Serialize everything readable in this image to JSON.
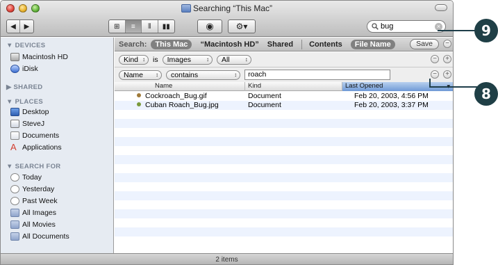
{
  "window": {
    "title": "Searching “This Mac”"
  },
  "toolbar": {
    "back": "◀",
    "forward": "▶",
    "view_icon": "⊞",
    "view_list": "≡",
    "view_column": "⫴",
    "view_coverflow": "▮▮",
    "quicklook": "◉",
    "action": "⚙▾",
    "search_value": "bug",
    "search_icon": "search-icon"
  },
  "sidebar": {
    "devices_header": "▼ DEVICES",
    "devices": [
      "Macintosh HD",
      "iDisk"
    ],
    "shared_header": "▶ SHARED",
    "places_header": "▼ PLACES",
    "places": [
      "Desktop",
      "SteveJ",
      "Documents",
      "Applications"
    ],
    "search_header": "▼ SEARCH FOR",
    "searches": [
      "Today",
      "Yesterday",
      "Past Week",
      "All Images",
      "All Movies",
      "All Documents"
    ]
  },
  "scope": {
    "label": "Search:",
    "this_mac": "This Mac",
    "macintosh_hd": "“Macintosh HD”",
    "shared": "Shared",
    "contents": "Contents",
    "file_name": "File Name",
    "save": "Save"
  },
  "criteria": [
    {
      "attr": "Kind",
      "op": "is",
      "value": "Images",
      "extra": "All"
    },
    {
      "attr": "Name",
      "op": "contains",
      "value": "roach"
    }
  ],
  "columns": {
    "name": "Name",
    "kind": "Kind",
    "last_opened": "Last Opened"
  },
  "files": [
    {
      "name": "Cockroach_Bug.gif",
      "kind": "Document",
      "last_opened": "Feb 20, 2003, 4:56 PM"
    },
    {
      "name": "Cuban Roach_Bug.jpg",
      "kind": "Document",
      "last_opened": "Feb 20, 2003, 3:37 PM"
    }
  ],
  "status": "2 items",
  "callouts": [
    "9",
    "8"
  ],
  "colors": {
    "callout": "#1f3f46",
    "sidebar_bg": "#e6ebf2",
    "row_alt": "#edf3fe"
  }
}
